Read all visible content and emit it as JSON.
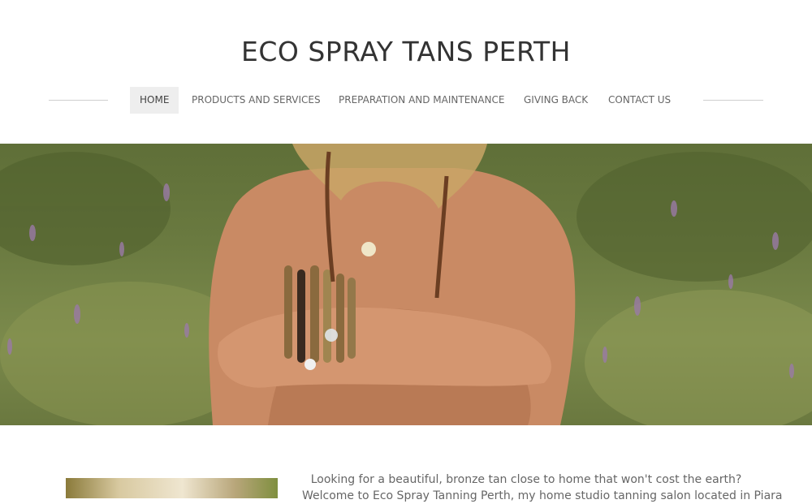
{
  "site": {
    "title": "ECO SPRAY TANS PERTH"
  },
  "nav": {
    "items": [
      {
        "label": "HOME",
        "active": true
      },
      {
        "label": "PRODUCTS AND SERVICES",
        "active": false
      },
      {
        "label": "PREPARATION AND MAINTENANCE",
        "active": false
      },
      {
        "label": "GIVING BACK",
        "active": false
      },
      {
        "label": "CONTACT US",
        "active": false
      }
    ]
  },
  "hero": {
    "image_subject": "hero-photo"
  },
  "intro": {
    "line1": "Looking for a beautiful, bronze tan close to home that won't cost the earth?",
    "line2": "Welcome to Eco Spray Tanning Perth, my home studio tanning salon located in Piara"
  },
  "colors": {
    "background": "#ffffff",
    "nav_active_bg": "#eeeeee",
    "title_text": "#333333",
    "nav_text": "#666666"
  }
}
